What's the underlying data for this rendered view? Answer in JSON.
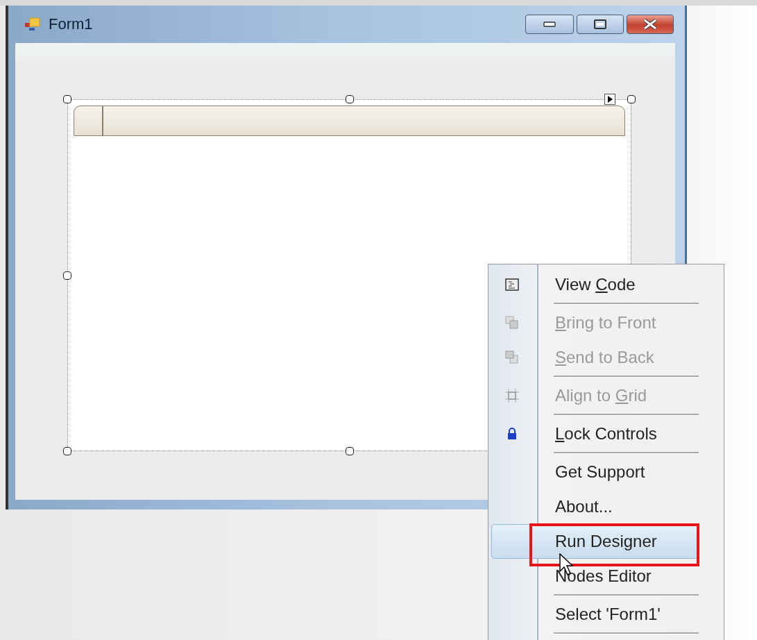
{
  "window": {
    "title": "Form1",
    "buttons": [
      {
        "kind": "minimize"
      },
      {
        "kind": "maximize"
      },
      {
        "kind": "close"
      }
    ]
  },
  "designer": {
    "control": {
      "selected": true
    }
  },
  "context_menu": {
    "items": [
      {
        "before": "View ",
        "key": "C",
        "after": "ode",
        "disabled": false,
        "selected": false,
        "separator_after": true
      },
      {
        "key": "B",
        "after": "ring to Front",
        "disabled": true,
        "selected": false,
        "separator_after": false
      },
      {
        "key": "S",
        "after": "end to Back",
        "disabled": true,
        "selected": false,
        "separator_after": true
      },
      {
        "before": "Align to ",
        "key": "G",
        "after": "rid",
        "disabled": true,
        "selected": false,
        "separator_after": true
      },
      {
        "key": "L",
        "after": "ock Controls",
        "disabled": false,
        "selected": false,
        "separator_after": true
      },
      {
        "label": "Get Support",
        "disabled": false,
        "selected": false,
        "separator_after": false
      },
      {
        "label": "About...",
        "disabled": false,
        "selected": false,
        "separator_after": false
      },
      {
        "label": "Run Designer",
        "disabled": false,
        "selected": true,
        "separator_after": false
      },
      {
        "label": "Nodes Editor",
        "disabled": false,
        "selected": false,
        "separator_after": true
      },
      {
        "label": "Select 'Form1'",
        "disabled": false,
        "selected": false,
        "separator_after": true
      }
    ]
  }
}
